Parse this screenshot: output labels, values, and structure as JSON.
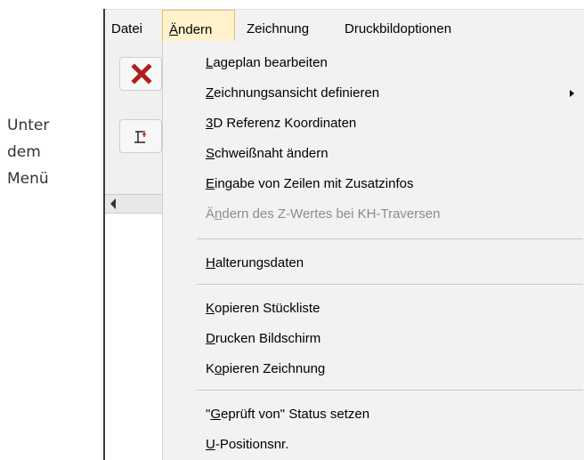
{
  "caption": {
    "lines": [
      "Unter",
      "dem",
      "Menü"
    ]
  },
  "menubar": {
    "items": [
      {
        "label": "Datei",
        "pre": "",
        "ul": "",
        "post": "Datei"
      },
      {
        "label": "Ändern",
        "pre": "",
        "ul": "Ä",
        "post": "ndern"
      },
      {
        "label": "Zeichnung",
        "pre": "",
        "ul": "",
        "post": "Zeichnung"
      },
      {
        "label": "Druckbildoptionen",
        "pre": "",
        "ul": "",
        "post": "Druckbildoptionen"
      }
    ],
    "active": "Ändern"
  },
  "toolbar": {
    "close_icon": "x-icon",
    "tool_icon": "frame-tool-icon",
    "accent": "#b01c1c"
  },
  "dropdown": {
    "items": [
      {
        "pre": "",
        "ul": "L",
        "post": "ageplan bearbeiten",
        "disabled": false,
        "submenu": false
      },
      {
        "pre": "",
        "ul": "Z",
        "post": "eichnungsansicht definieren",
        "disabled": false,
        "submenu": true
      },
      {
        "pre": "",
        "ul": "3",
        "post": "D Referenz Koordinaten",
        "disabled": false,
        "submenu": false
      },
      {
        "pre": "",
        "ul": "S",
        "post": "chweißnaht ändern",
        "disabled": false,
        "submenu": false
      },
      {
        "pre": "",
        "ul": "E",
        "post": "ingabe von Zeilen mit Zusatzinfos",
        "disabled": false,
        "submenu": false
      },
      {
        "pre": "Ä",
        "ul": "n",
        "post": "dern des Z-Wertes bei KH-Traversen",
        "disabled": true,
        "submenu": false
      },
      {
        "pre": "",
        "ul": "H",
        "post": "alterungsdaten",
        "disabled": false,
        "submenu": false
      },
      {
        "pre": "",
        "ul": "K",
        "post": "opieren Stückliste",
        "disabled": false,
        "submenu": false
      },
      {
        "pre": "",
        "ul": "D",
        "post": "rucken Bildschirm",
        "disabled": false,
        "submenu": false
      },
      {
        "pre": "K",
        "ul": "o",
        "post": "pieren Zeichnung",
        "disabled": false,
        "submenu": false
      },
      {
        "pre": "\"",
        "ul": "G",
        "post": "eprüft von\" Status setzen",
        "disabled": false,
        "submenu": false
      },
      {
        "pre": "",
        "ul": "U",
        "post": "-Positionsnr.",
        "disabled": false,
        "submenu": false
      }
    ]
  }
}
